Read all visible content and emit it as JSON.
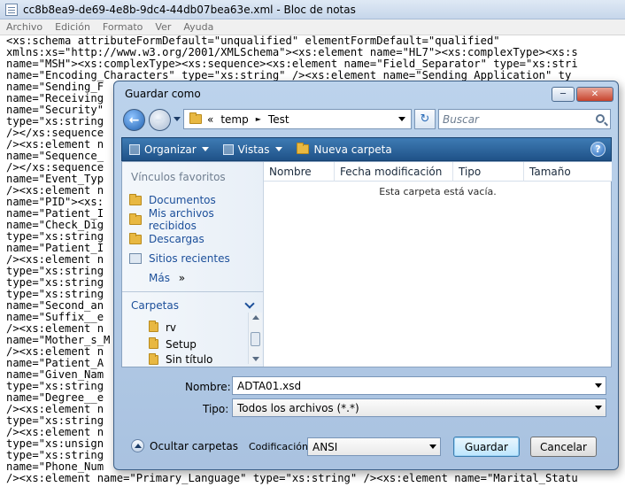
{
  "notepad": {
    "title": "cc8b8ea9-de69-4e8b-9dc4-44db07bea63e.xml - Bloc de notas",
    "menu": [
      "Archivo",
      "Edición",
      "Formato",
      "Ver",
      "Ayuda"
    ],
    "lines": [
      "<xs:schema attributeFormDefault=\"unqualified\" elementFormDefault=\"qualified\"",
      "xmlns:xs=\"http://www.w3.org/2001/XMLSchema\"><xs:element name=\"HL7\"><xs:complexType><xs:s",
      "name=\"MSH\"><xs:complexType><xs:sequence><xs:element name=\"Field_Separator\" type=\"xs:stri",
      "name=\"Encoding_Characters\" type=\"xs:string\" /><xs:element name=\"Sending_Application\" ty",
      "name=\"Sending_F",
      "name=\"Receiving",
      "name=\"Security\"",
      "type=\"xs:string",
      "/></xs:sequence",
      "/><xs:element n",
      "name=\"Sequence_",
      "/></xs:sequence",
      "name=\"Event_Typ",
      "/><xs:element n",
      "name=\"PID\"><xs:",
      "name=\"Patient_I",
      "name=\"Check_Dig",
      "type=\"xs:string",
      "name=\"Patient_I",
      "/><xs:element n",
      "type=\"xs:string",
      "type=\"xs:string",
      "type=\"xs:string",
      "name=\"Second_an",
      "name=\"Suffix__e",
      "/><xs:element n",
      "name=\"Mother_s_M",
      "/><xs:element n",
      "name=\"Patient_A",
      "name=\"Given_Nam",
      "type=\"xs:string",
      "name=\"Degree__e",
      "/><xs:element n",
      "type=\"xs:string",
      "/><xs:element n",
      "type=\"xs:unsign",
      "type=\"xs:string",
      "name=\"Phone_Num",
      "/><xs:element name=\"Primary_Language\" type=\"xs:string\" /><xs:element name=\"Marital_Statu"
    ]
  },
  "dialog": {
    "title": "Guardar como",
    "window_buttons": [
      "─",
      "□",
      "✕"
    ],
    "address": {
      "sep": "«",
      "path": [
        "temp",
        "Test"
      ],
      "arrow": "►"
    },
    "search_placeholder": "Buscar",
    "refresh_glyph": "↻",
    "toolbar": {
      "organize": "Organizar",
      "views": "Vistas",
      "new_folder": "Nueva carpeta",
      "help": "?"
    },
    "sidebar": {
      "favorites_header": "Vínculos favoritos",
      "favorites": [
        "Documentos",
        "Mis archivos recibidos",
        "Descargas",
        "Sitios recientes"
      ],
      "more": "Más",
      "more_glyph": "»",
      "folders_header": "Carpetas",
      "tree": [
        "rv",
        "Setup",
        "Sin título"
      ]
    },
    "columns": [
      "Nombre",
      "Fecha modificación",
      "Tipo",
      "Tamaño"
    ],
    "empty_message": "Esta carpeta está vacía.",
    "filename_label": "Nombre:",
    "filename_value": "ADTA01.xsd",
    "type_label": "Tipo:",
    "type_value": "Todos los archivos  (*.*)",
    "hide_folders": "Ocultar carpetas",
    "encoding_label": "Codificación:",
    "encoding_value": "ANSI",
    "save": "Guardar",
    "cancel": "Cancelar"
  }
}
